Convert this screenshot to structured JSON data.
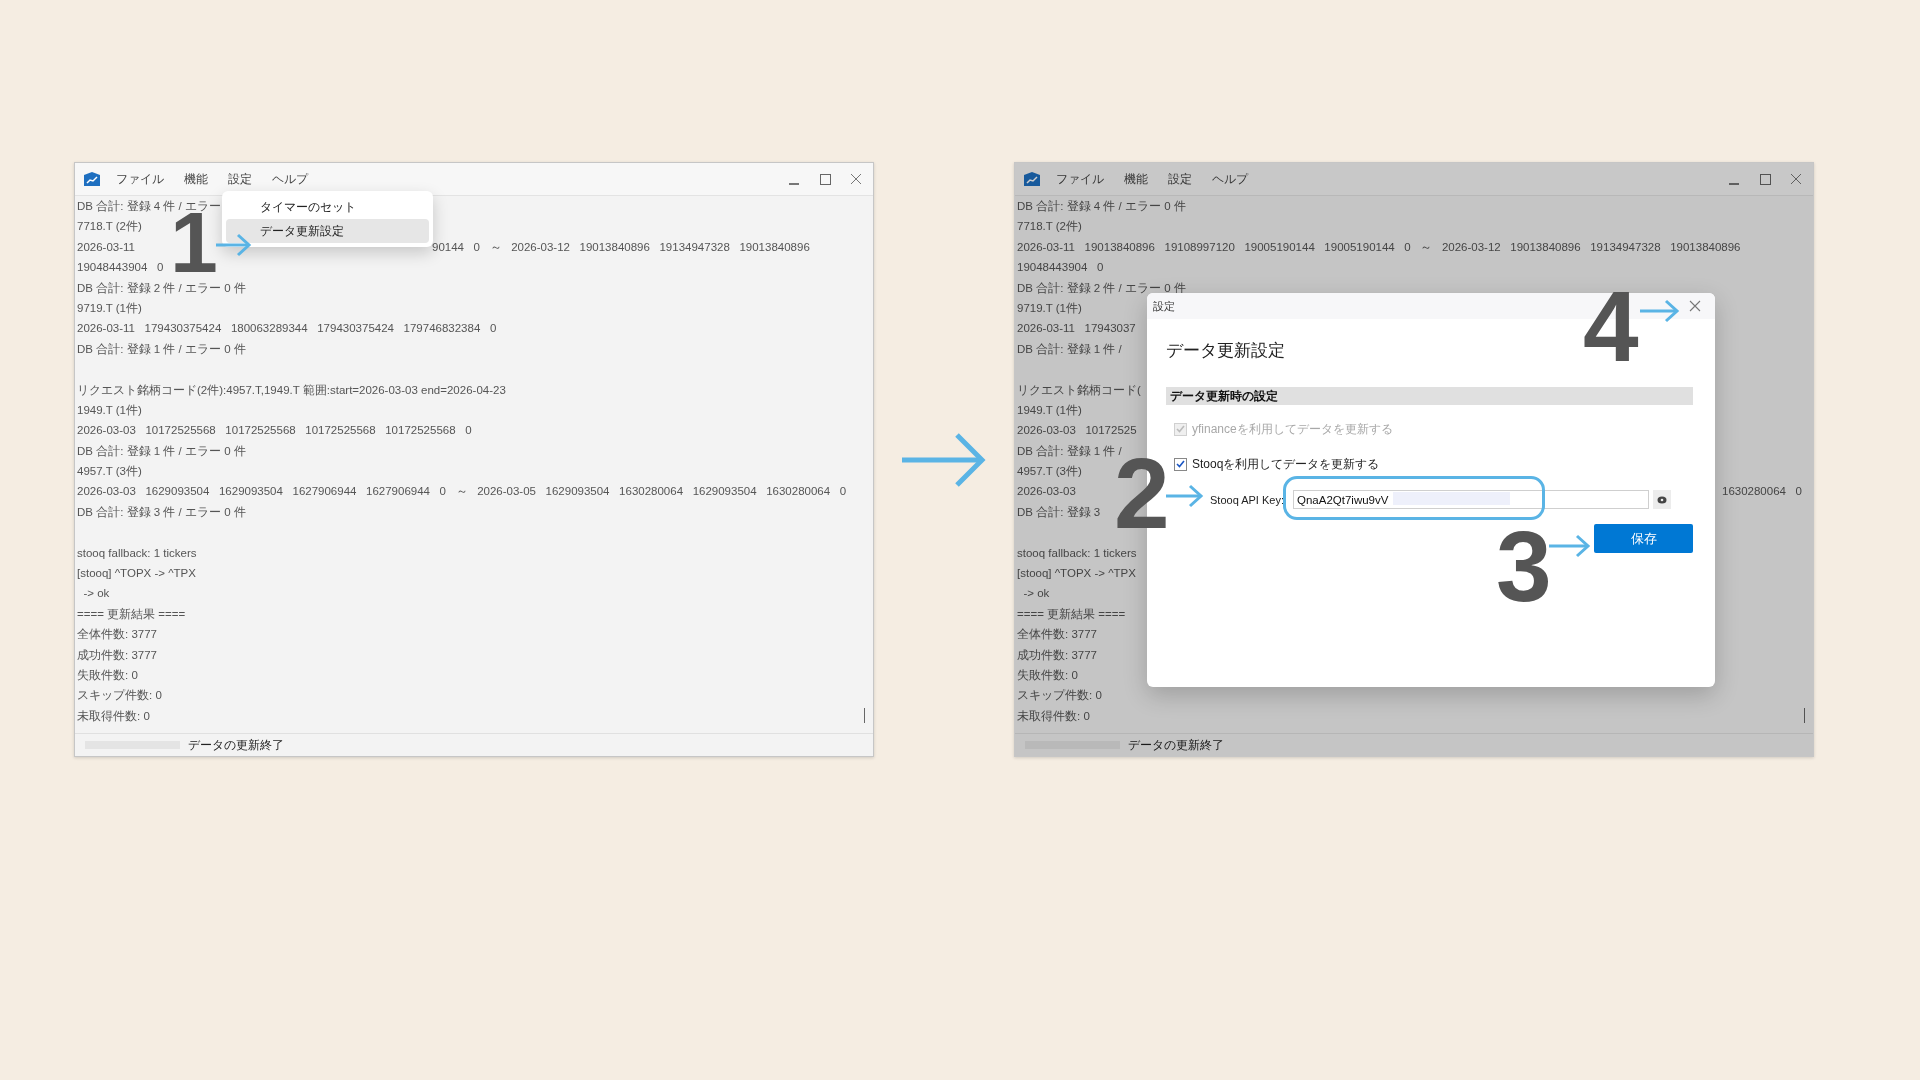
{
  "left_window": {
    "menu": [
      "ファイル",
      "機能",
      "設定",
      "ヘルプ"
    ],
    "log_lines": [
      {
        "kind": "text",
        "text": "DB 合計: 登録 4 件 / エラー"
      },
      {
        "kind": "text",
        "text": "7718.T (2件)"
      },
      {
        "kind": "text",
        "text": "2026-03-11",
        "resume": "90144   0   ～   2026-03-12   19013840896   19134947328   19013840896"
      },
      {
        "kind": "text",
        "text": "19048443904   0"
      },
      {
        "kind": "text",
        "text": "DB 合計: 登録 2 件 / エラー 0 件"
      },
      {
        "kind": "text",
        "text": "9719.T (1件)"
      },
      {
        "kind": "text",
        "text": "2026-03-11   179430375424   180063289344   179430375424   179746832384   0"
      },
      {
        "kind": "text",
        "text": "DB 合計: 登録 1 件 / エラー 0 件"
      },
      {
        "kind": "blank"
      },
      {
        "kind": "text",
        "text": "リクエスト銘柄コード(2件):4957.T,1949.T 範囲:start=2026-03-03 end=2026-04-23"
      },
      {
        "kind": "text",
        "text": "1949.T (1件)"
      },
      {
        "kind": "text",
        "text": "2026-03-03   10172525568   10172525568   10172525568   10172525568   0"
      },
      {
        "kind": "text",
        "text": "DB 合計: 登録 1 件 / エラー 0 件"
      },
      {
        "kind": "text",
        "text": "4957.T (3件)"
      },
      {
        "kind": "text",
        "text": "2026-03-03   1629093504   1629093504   1627906944   1627906944   0   ～   2026-03-05   1629093504   1630280064   1629093504   1630280064   0"
      },
      {
        "kind": "text",
        "text": "DB 合計: 登録 3 件 / エラー 0 件"
      },
      {
        "kind": "blank"
      },
      {
        "kind": "text",
        "text": "stooq fallback: 1 tickers"
      },
      {
        "kind": "text",
        "text": "[stooq] ^TOPX -> ^TPX"
      },
      {
        "kind": "text",
        "text": "  -> ok"
      },
      {
        "kind": "text",
        "text": "==== 更新結果 ===="
      },
      {
        "kind": "text",
        "text": "全体件数: 3777"
      },
      {
        "kind": "text",
        "text": "成功件数: 3777"
      },
      {
        "kind": "text",
        "text": "失敗件数: 0"
      },
      {
        "kind": "text",
        "text": "スキップ件数: 0"
      },
      {
        "kind": "text",
        "text": "未取得件数: 0"
      }
    ],
    "dropdown": [
      {
        "label": "タイマーのセット",
        "selected": false
      },
      {
        "label": "データ更新設定",
        "selected": true
      }
    ],
    "status_bar": {
      "progress": {
        "level": 0
      },
      "text": "データの更新終了"
    }
  },
  "right_window": {
    "menu": [
      "ファイル",
      "機能",
      "設定",
      "ヘルプ"
    ],
    "log_lines": [
      {
        "kind": "text",
        "text": "DB 合計: 登録 4 件 / エラー 0 件"
      },
      {
        "kind": "text",
        "text": "7718.T (2件)"
      },
      {
        "kind": "text",
        "text": "2026-03-11   19013840896   19108997120   19005190144   19005190144   0   ～   2026-03-12   19013840896   19134947328   19013840896"
      },
      {
        "kind": "text",
        "text": "19048443904   0"
      },
      {
        "kind": "text",
        "text": "DB 合計: 登録 2 件 / エラー 0 件"
      },
      {
        "kind": "text",
        "text": "9719.T (1件)"
      },
      {
        "kind": "text",
        "text": "2026-03-11   17943037"
      },
      {
        "kind": "text",
        "text": "DB 合計: 登録 1 件 /"
      },
      {
        "kind": "blank"
      },
      {
        "kind": "text",
        "text": "リクエスト銘柄コード("
      },
      {
        "kind": "text",
        "text": "1949.T (1件)"
      },
      {
        "kind": "text",
        "text": "2026-03-03   10172525"
      },
      {
        "kind": "text",
        "text": "DB 合計: 登録 1 件 /"
      },
      {
        "kind": "text",
        "text": "4957.T (3件)"
      },
      {
        "kind": "text",
        "text": "2026-03-03",
        "resume": "1630280064   0"
      },
      {
        "kind": "text",
        "text": "DB 合計: 登録 3"
      },
      {
        "kind": "blank"
      },
      {
        "kind": "text",
        "text": "stooq fallback: 1 tickers"
      },
      {
        "kind": "text",
        "text": "[stooq] ^TOPX -> ^TPX"
      },
      {
        "kind": "text",
        "text": "  -> ok"
      },
      {
        "kind": "text",
        "text": "==== 更新結果 ===="
      },
      {
        "kind": "text",
        "text": "全体件数: 3777"
      },
      {
        "kind": "text",
        "text": "成功件数: 3777"
      },
      {
        "kind": "text",
        "text": "失敗件数: 0"
      },
      {
        "kind": "text",
        "text": "スキップ件数: 0"
      },
      {
        "kind": "text",
        "text": "未取得件数: 0"
      }
    ],
    "status_bar": {
      "progress": {
        "level": 0
      },
      "text": "データの更新終了"
    },
    "dialog": {
      "window_title": "設定",
      "heading": "データ更新設定",
      "section": "データ更新時の設定",
      "options": [
        {
          "label": "yfinanceを利用してデータを更新する",
          "checked": true,
          "disabled": true
        },
        {
          "label": "Stooqを利用してデータを更新する",
          "checked": true,
          "disabled": false
        }
      ],
      "api_key": {
        "label": "Stooq API Key:",
        "value": "QnaA2Qt7iwu9vV"
      },
      "save_button": "保存"
    }
  },
  "annotations": [
    {
      "number": "1"
    },
    {
      "number": "2"
    },
    {
      "number": "3"
    },
    {
      "number": "4"
    }
  ]
}
